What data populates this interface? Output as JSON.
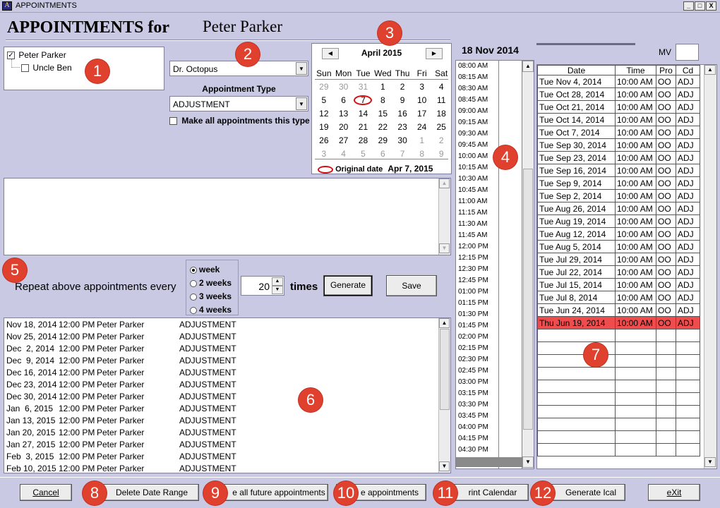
{
  "window": {
    "title": "APPOINTMENTS",
    "min": "_",
    "max": "□",
    "close": "X",
    "icon_glyph": "A"
  },
  "header": {
    "title": "APPOINTMENTS for",
    "patient": "Peter Parker"
  },
  "patients": [
    {
      "name": "Peter Parker",
      "checked": true
    },
    {
      "name": "Uncle Ben",
      "checked": false
    }
  ],
  "doctor_select": {
    "value": "Dr. Octopus"
  },
  "appt_type": {
    "label": "Appointment Type",
    "value": "ADJUSTMENT",
    "make_all_label": "Make all appointments this type"
  },
  "calendar": {
    "month": "April 2015",
    "weekdays": [
      "Sun",
      "Mon",
      "Tue",
      "Wed",
      "Thu",
      "Fri",
      "Sat"
    ],
    "weeks": [
      [
        "29",
        "30",
        "31",
        "1",
        "2",
        "3",
        "4"
      ],
      [
        "5",
        "6",
        "7",
        "8",
        "9",
        "10",
        "11"
      ],
      [
        "12",
        "13",
        "14",
        "15",
        "16",
        "17",
        "18"
      ],
      [
        "19",
        "20",
        "21",
        "22",
        "23",
        "24",
        "25"
      ],
      [
        "26",
        "27",
        "28",
        "29",
        "30",
        "1",
        "2"
      ],
      [
        "3",
        "4",
        "5",
        "6",
        "7",
        "8",
        "9"
      ]
    ],
    "original_label": "Original date",
    "original_date": "Apr 7, 2015"
  },
  "schedule": {
    "date": "18 Nov 2014",
    "mv_label": "MV",
    "times": [
      "08:00 AM",
      "08:15 AM",
      "08:30 AM",
      "08:45 AM",
      "09:00 AM",
      "09:15 AM",
      "09:30 AM",
      "09:45 AM",
      "10:00 AM",
      "10:15 AM",
      "10:30 AM",
      "10:45 AM",
      "11:00 AM",
      "11:15 AM",
      "11:30 AM",
      "11:45 AM",
      "12:00 PM",
      "12:15 PM",
      "12:30 PM",
      "12:45 PM",
      "01:00 PM",
      "01:15 PM",
      "01:30 PM",
      "01:45 PM",
      "02:00 PM",
      "02:15 PM",
      "02:30 PM",
      "02:45 PM",
      "03:00 PM",
      "03:15 PM",
      "03:30 PM",
      "03:45 PM",
      "04:00 PM",
      "04:15 PM",
      "04:30 PM"
    ]
  },
  "history": {
    "headers": [
      "Date",
      "Time",
      "Pro",
      "Cd"
    ],
    "rows": [
      [
        "Tue Nov 4, 2014",
        "10:00 AM",
        "OO",
        "ADJ"
      ],
      [
        "Tue Oct 28, 2014",
        "10:00 AM",
        "OO",
        "ADJ"
      ],
      [
        "Tue Oct 21, 2014",
        "10:00 AM",
        "OO",
        "ADJ"
      ],
      [
        "Tue Oct 14, 2014",
        "10:00 AM",
        "OO",
        "ADJ"
      ],
      [
        "Tue Oct 7, 2014",
        "10:00 AM",
        "OO",
        "ADJ"
      ],
      [
        "Tue Sep 30, 2014",
        "10:00 AM",
        "OO",
        "ADJ"
      ],
      [
        "Tue Sep 23, 2014",
        "10:00 AM",
        "OO",
        "ADJ"
      ],
      [
        "Tue Sep 16, 2014",
        "10:00 AM",
        "OO",
        "ADJ"
      ],
      [
        "Tue Sep 9, 2014",
        "10:00 AM",
        "OO",
        "ADJ"
      ],
      [
        "Tue Sep 2, 2014",
        "10:00 AM",
        "OO",
        "ADJ"
      ],
      [
        "Tue Aug 26, 2014",
        "10:00 AM",
        "OO",
        "ADJ"
      ],
      [
        "Tue Aug 19, 2014",
        "10:00 AM",
        "OO",
        "ADJ"
      ],
      [
        "Tue Aug 12, 2014",
        "10:00 AM",
        "OO",
        "ADJ"
      ],
      [
        "Tue Aug 5, 2014",
        "10:00 AM",
        "OO",
        "ADJ"
      ],
      [
        "Tue Jul 29, 2014",
        "10:00 AM",
        "OO",
        "ADJ"
      ],
      [
        "Tue Jul 22, 2014",
        "10:00 AM",
        "OO",
        "ADJ"
      ],
      [
        "Tue Jul 15, 2014",
        "10:00 AM",
        "OO",
        "ADJ"
      ],
      [
        "Tue Jul 8, 2014",
        "10:00 AM",
        "OO",
        "ADJ"
      ],
      [
        "Tue Jun 24, 2014",
        "10:00 AM",
        "OO",
        "ADJ"
      ],
      [
        "Thu Jun 19, 2014",
        "10:00 AM",
        "OO",
        "ADJ"
      ]
    ],
    "selected_row": 19
  },
  "repeat": {
    "label": "Repeat above appointments every",
    "options": [
      "week",
      "2 weeks",
      "3 weeks",
      "4 weeks"
    ],
    "count": "20",
    "times_label": "times",
    "generate_label": "Generate",
    "save_label": "Save"
  },
  "generated": [
    [
      "Nov 18, 2014",
      "12:00 PM",
      "Peter Parker",
      "ADJUSTMENT"
    ],
    [
      "Nov 25, 2014",
      "12:00 PM",
      "Peter Parker",
      "ADJUSTMENT"
    ],
    [
      "Dec  2, 2014",
      "12:00 PM",
      "Peter Parker",
      "ADJUSTMENT"
    ],
    [
      "Dec  9, 2014",
      "12:00 PM",
      "Peter Parker",
      "ADJUSTMENT"
    ],
    [
      "Dec 16, 2014",
      "12:00 PM",
      "Peter Parker",
      "ADJUSTMENT"
    ],
    [
      "Dec 23, 2014",
      "12:00 PM",
      "Peter Parker",
      "ADJUSTMENT"
    ],
    [
      "Dec 30, 2014",
      "12:00 PM",
      "Peter Parker",
      "ADJUSTMENT"
    ],
    [
      "Jan  6, 2015",
      "12:00 PM",
      "Peter Parker",
      "ADJUSTMENT"
    ],
    [
      "Jan 13, 2015",
      "12:00 PM",
      "Peter Parker",
      "ADJUSTMENT"
    ],
    [
      "Jan 20, 2015",
      "12:00 PM",
      "Peter Parker",
      "ADJUSTMENT"
    ],
    [
      "Jan 27, 2015",
      "12:00 PM",
      "Peter Parker",
      "ADJUSTMENT"
    ],
    [
      "Feb  3, 2015",
      "12:00 PM",
      "Peter Parker",
      "ADJUSTMENT"
    ],
    [
      "Feb 10, 2015",
      "12:00 PM",
      "Peter Parker",
      "ADJUSTMENT"
    ]
  ],
  "footer": {
    "cancel": "Cancel",
    "delete_range": "Delete Date Range",
    "delete_future": "e all future appointments",
    "appointments": "e appointments",
    "print_calendar": "rint Calendar",
    "generate_ical": "Generate Ical",
    "exit": "eXit"
  },
  "badges": [
    "1",
    "2",
    "3",
    "4",
    "5",
    "6",
    "7",
    "8",
    "9",
    "10",
    "11",
    "12"
  ],
  "colors": {
    "background": "#c9c9e3",
    "selected_row": "#ef4d4d",
    "badge": "#e0402e",
    "original_circle": "#d41010"
  }
}
